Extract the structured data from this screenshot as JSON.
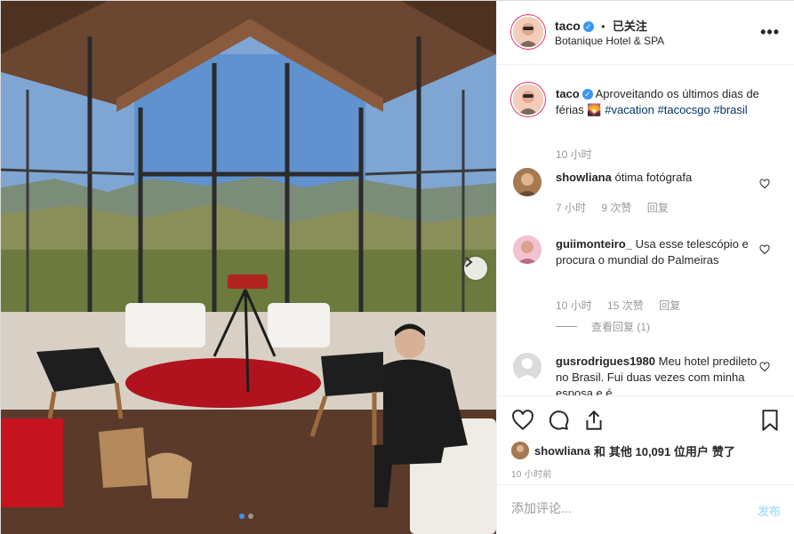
{
  "post": {
    "author": "taco",
    "follow_status": "已关注",
    "location": "Botanique Hotel & SPA",
    "more_icon": "more-options-icon"
  },
  "caption": {
    "author": "taco",
    "text": "Aproveitando os últimos dias de férias 🌄",
    "hashtags": [
      "#vacation",
      "#tacocsgo",
      "#brasil"
    ],
    "time": "10 小时"
  },
  "comments": [
    {
      "user": "showliana",
      "text": "ótima fotógrafa",
      "time": "7 小时",
      "likes": "9 次赞",
      "reply": "回复"
    },
    {
      "user": "guiimonteiro_",
      "text": "Usa esse telescópio e procura o mundial do Palmeiras",
      "time": "10 小时",
      "likes": "15 次赞",
      "reply": "回复",
      "view_replies": "查看回复 (1)"
    },
    {
      "user": "gusrodrigues1980",
      "text": "Meu hotel predileto no Brasil. Fui duas vezes com minha esposa e é"
    }
  ],
  "likes": {
    "first_user": "showliana",
    "connector": "和",
    "others": "其他 10,091 位用户",
    "suffix": "赞了"
  },
  "time_ago": "10 小时前",
  "add_comment": {
    "placeholder": "添加评论...",
    "post_label": "发布"
  },
  "carousel": {
    "current": 1,
    "total": 2
  },
  "colors": {
    "accent": "#3897f0",
    "text": "#262626",
    "muted": "#999999",
    "tag": "#003569",
    "post_disabled": "#b2dffc"
  }
}
